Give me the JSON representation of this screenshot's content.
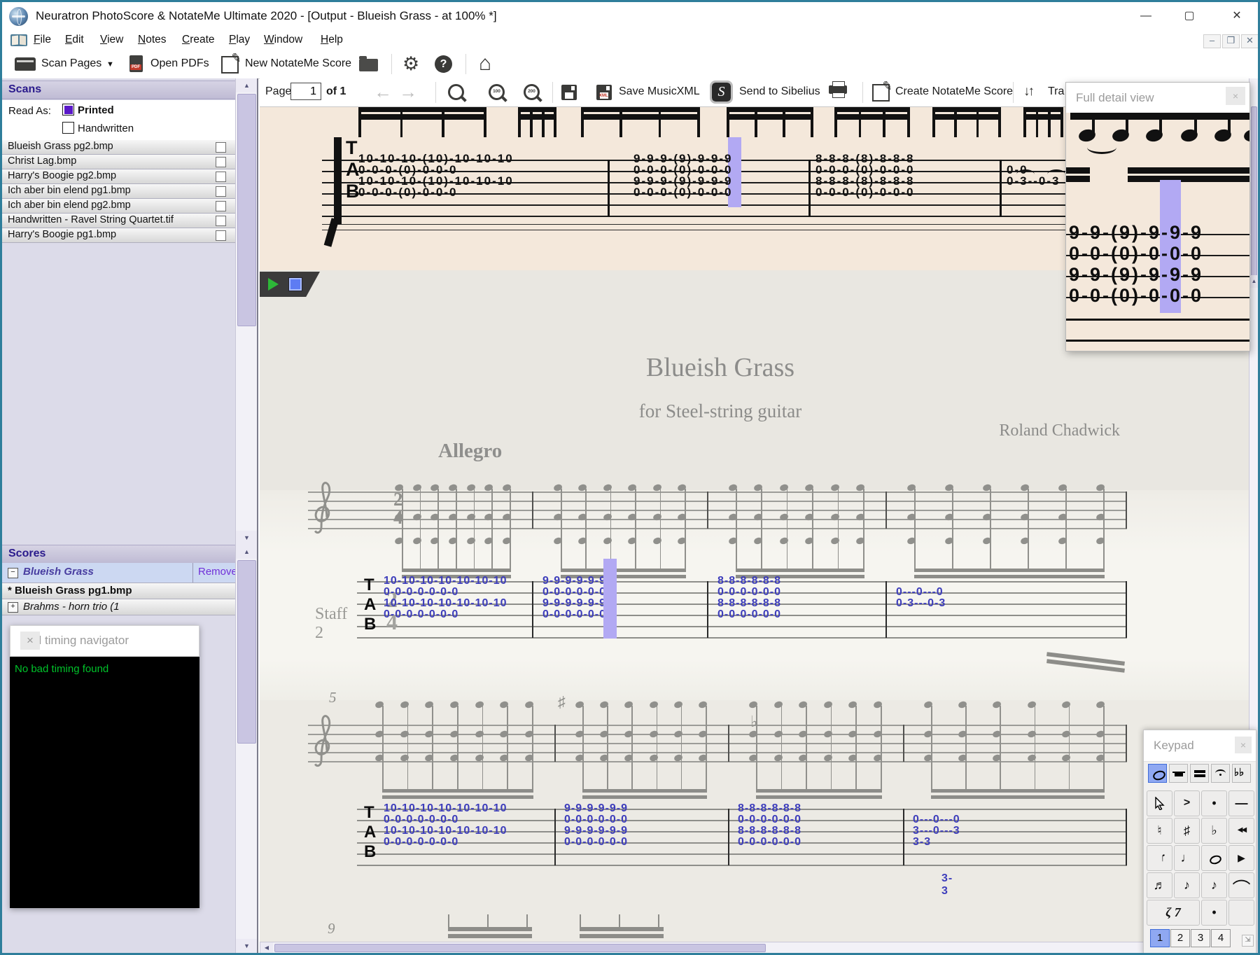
{
  "window": {
    "title": "Neuratron PhotoScore & NotateMe Ultimate 2020 - [Output - Blueish Grass - at 100% *]",
    "controls": {
      "minimize": "—",
      "maximize": "▢",
      "close": "✕"
    },
    "mdi_controls": {
      "minimize": "–",
      "restore": "❐",
      "close": "✕"
    }
  },
  "menu_bar": {
    "items": [
      "File",
      "Edit",
      "View",
      "Notes",
      "Create",
      "Play",
      "Window",
      "Help"
    ]
  },
  "toolbar": {
    "scan_pages": "Scan Pages",
    "open_pdfs": "Open PDFs",
    "new_notateme_score": "New NotateMe Score"
  },
  "scans_panel": {
    "title": "Scans",
    "read_as_label": "Read As:",
    "read_options": [
      {
        "label": "Printed",
        "checked": true
      },
      {
        "label": "Handwritten",
        "checked": false
      }
    ],
    "files": [
      "Blueish Grass pg2.bmp",
      "Christ Lag.bmp",
      "Harry's Boogie pg2.bmp",
      "Ich aber bin elend pg1.bmp",
      "Ich aber bin elend pg2.bmp",
      "Handwritten - Ravel String Quartet.tif",
      "Harry's Boogie pg1.bmp"
    ]
  },
  "scores_panel": {
    "title": "Scores",
    "remove_label": "Remove",
    "items": [
      {
        "label": "Blueish Grass",
        "marker": "minus",
        "selected": true,
        "italic": true
      },
      {
        "label": "* Blueish Grass pg1.bmp",
        "bold": true
      },
      {
        "label": "Brahms - horn trio (1",
        "marker": "plus",
        "italic": true
      }
    ]
  },
  "bad_timing_panel": {
    "title": "Bad timing navigator",
    "message": "No bad timing found"
  },
  "page_toolbar": {
    "page_label": "Page",
    "page_value": "1",
    "page_of": "of 1",
    "zoom_badges": [
      "",
      "100",
      "200"
    ],
    "save_musicxml": "Save MusicXML",
    "send_to_sibelius": "Send to Sibelius",
    "create_notateme_score": "Create NotateMe Score",
    "transpose_clipped": "Tra"
  },
  "scan_view": {
    "tab_label": "TAB",
    "measures": [
      {
        "rows": [
          "10-10-10-(10)-10-10-10",
          "0-0-0-(0)-0-0-0",
          "10-10-10-(10)-10-10-10",
          "0-0-0-(0)-0-0-0"
        ]
      },
      {
        "rows": [
          "9-9-9-(9)-9-9-9",
          "0-0-0-(0)-0-0-0",
          "9-9-9-(9)-9-9-9",
          "0-0-0-(0)-0-0-0"
        ],
        "highlight": true
      },
      {
        "rows": [
          "8-8-8-(8)-8-8-8",
          "0-0-0-(0)-0-0-0",
          "8-8-8-(8)-8-8-8",
          "0-0-0-(0)-0-0-0"
        ]
      },
      {
        "rows": [
          "",
          "0-0",
          "0-3--0-3",
          ""
        ]
      }
    ]
  },
  "score_view": {
    "title": "Blueish Grass",
    "subtitle": "for Steel-string guitar",
    "composer": "Roland Chadwick",
    "tempo": "Allegro",
    "staff_label": "Staff 2",
    "tab_label": "TAB",
    "time_signature": {
      "top": "2",
      "bottom": "4"
    },
    "measure_numbers": [
      "5",
      "9"
    ],
    "extra_tab_figure": "3-3",
    "system1_tab": [
      {
        "rows": [
          "10-10-10-10-10-10-10",
          "0-0-0-0-0-0-0",
          "10-10-10-10-10-10-10",
          "0-0-0-0-0-0-0"
        ]
      },
      {
        "rows": [
          "9-9-9-9-9-9",
          "0-0-0-0-0-0",
          "9-9-9-9-9-9",
          "0-0-0-0-0-0"
        ],
        "highlight": true
      },
      {
        "rows": [
          "8-8-8-8-8-8",
          "0-0-0-0-0-0",
          "8-8-8-8-8-8",
          "0-0-0-0-0-0"
        ]
      },
      {
        "rows": [
          "",
          "0---0---0",
          "0-3---0-3",
          ""
        ]
      }
    ],
    "system2_tab": [
      {
        "rows": [
          "10-10-10-10-10-10-10",
          "0-0-0-0-0-0-0",
          "10-10-10-10-10-10-10",
          "0-0-0-0-0-0-0"
        ]
      },
      {
        "rows": [
          "9-9-9-9-9-9",
          "0-0-0-0-0-0",
          "9-9-9-9-9-9",
          "0-0-0-0-0-0"
        ]
      },
      {
        "rows": [
          "8-8-8-8-8-8",
          "0-0-0-0-0-0",
          "8-8-8-8-8-8",
          "0-0-0-0-0-0"
        ]
      },
      {
        "rows": [
          "",
          "0---0---0",
          "3---0---3",
          "3-3"
        ]
      }
    ]
  },
  "full_detail_panel": {
    "title": "Full detail view",
    "tab_rows": [
      "9-9-(9)-9-9-9",
      "0-0-(0)-0-0-0",
      "9-9-(9)-9-9-9",
      "0-0-(0)-0-0-0"
    ]
  },
  "keypad_panel": {
    "title": "Keypad",
    "tabs": [
      {
        "name": "notes-tab"
      },
      {
        "name": "rests-tab"
      },
      {
        "name": "beams-tab"
      },
      {
        "name": "articulations-tab"
      },
      {
        "name": "accidentals-tab",
        "glyph": "♭♭"
      }
    ],
    "active_tab": 0,
    "grid": [
      {
        "name": "pointer-tool",
        "glyph": "cursor"
      },
      {
        "name": "accent",
        "glyph": ">"
      },
      {
        "name": "staccato-dot",
        "glyph": "•"
      },
      {
        "name": "tenuto",
        "glyph": "—"
      },
      {
        "name": "natural",
        "glyph": "♮"
      },
      {
        "name": "sharp",
        "glyph": "♯"
      },
      {
        "name": "flat",
        "glyph": "♭"
      },
      {
        "name": "rewind",
        "glyph": "◀◀"
      },
      {
        "name": "quarter-note-down",
        "glyph": "♩",
        "flip": true
      },
      {
        "name": "quarter-note",
        "glyph": "♩"
      },
      {
        "name": "whole-note",
        "glyph": "oval"
      },
      {
        "name": "play",
        "glyph": "▶"
      },
      {
        "name": "sixteenth-note",
        "glyph": "♬"
      },
      {
        "name": "eighth-note",
        "glyph": "♪"
      },
      {
        "name": "eighth-note-small",
        "glyph": "♪"
      },
      {
        "name": "tie",
        "glyph": "⌒"
      },
      {
        "name": "rests",
        "glyph": "ζ 7",
        "wide": true
      },
      {
        "name": "augmentation-dot",
        "glyph": "•"
      },
      {
        "name": "blank",
        "glyph": ""
      }
    ],
    "pages": [
      "1",
      "2",
      "3",
      "4"
    ],
    "active_page": "1"
  },
  "colors": {
    "window_border": "#2e7e9b",
    "scan_paper": "#f4e8db",
    "tab_number_blue": "#3d3dbb",
    "highlight_purple": "#b2a9f3",
    "ok_green": "#00c22a",
    "header_purple": "#2a1a8c"
  }
}
